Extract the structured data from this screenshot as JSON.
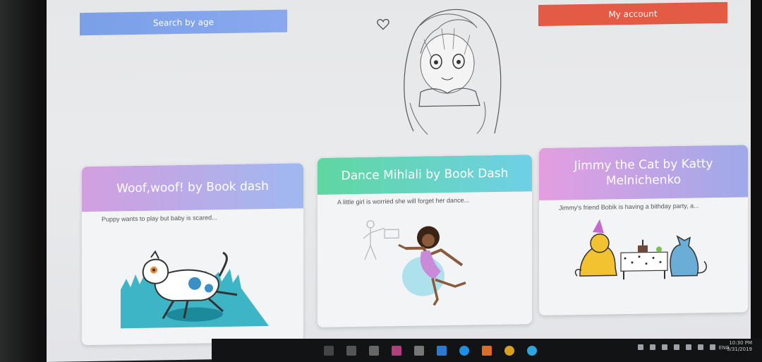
{
  "header": {
    "search_label": "Search by age",
    "account_label": "My account"
  },
  "cards": [
    {
      "title": "Woof,woof! by Book dash",
      "description": "Puppy wants to play but baby is scared..."
    },
    {
      "title": "Dance Mihlali by Book Dash",
      "description": "A little girl is worried she will forget her dance..."
    },
    {
      "title": "Jimmy the Cat by Katty Melnichenko",
      "description": "Jimmy's friend Bobik is having a bithday party, a..."
    }
  ],
  "taskbar": {
    "apps": [
      "app-1",
      "app-2",
      "app-3",
      "app-4",
      "app-5",
      "app-6",
      "app-7",
      "app-8",
      "app-9",
      "app-10",
      "app-11"
    ],
    "language": "ENG",
    "time": "10:30 PM",
    "date": "5/31/2019"
  }
}
